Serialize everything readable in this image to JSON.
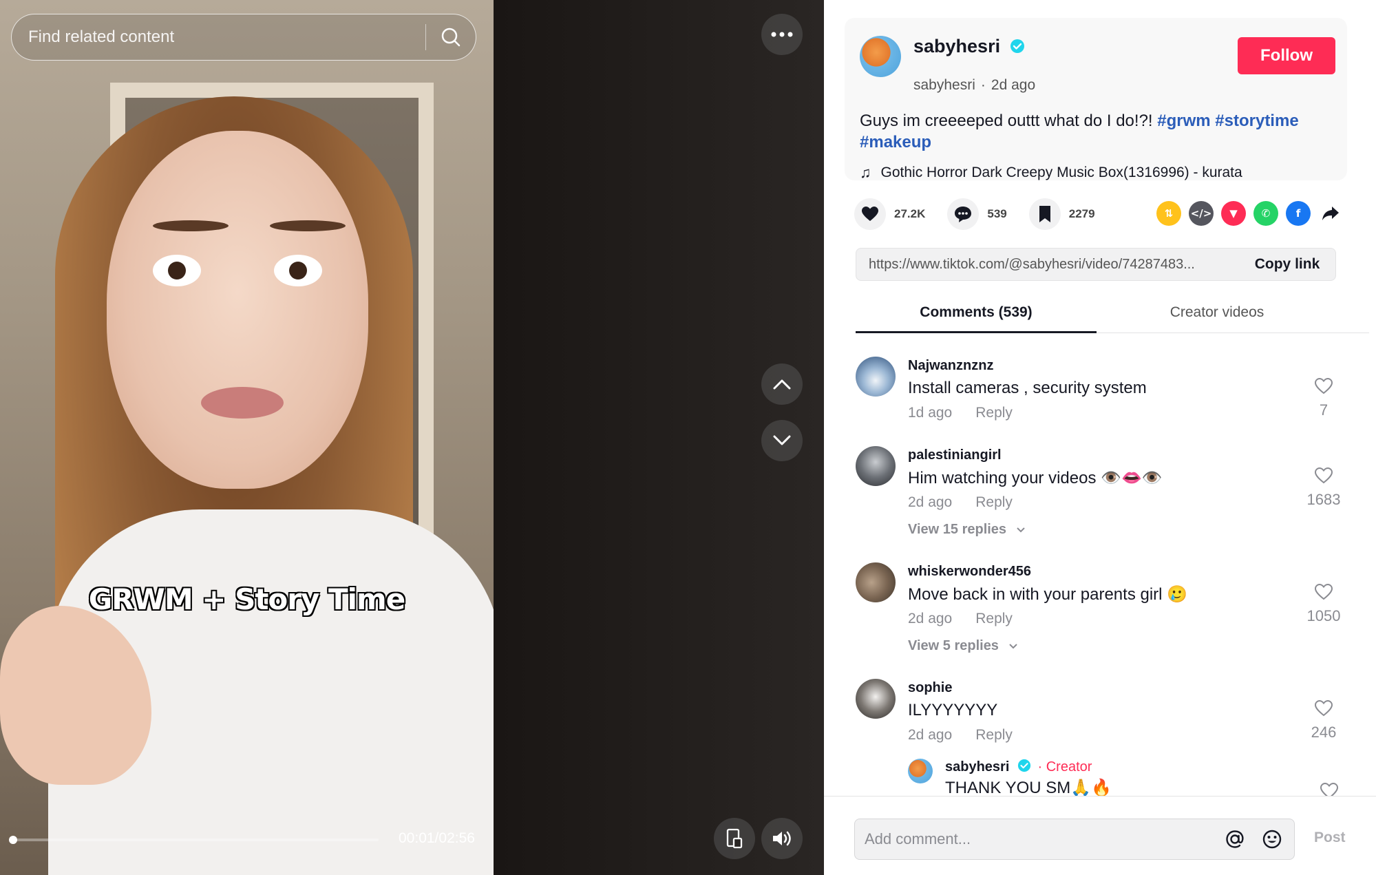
{
  "search": {
    "placeholder": "Find related content"
  },
  "video": {
    "caption": "GRWM + Story Time",
    "time": "00:01/02:56",
    "progress": 0.006
  },
  "author": {
    "display_name": "sabyhesri",
    "handle": "sabyhesri",
    "posted": "2d ago",
    "follow_label": "Follow"
  },
  "post": {
    "text": "Guys im creeeeped outtt what do I do!?! ",
    "hashtags": [
      "#grwm",
      "#storytime",
      "#makeup"
    ],
    "music": "Gothic Horror Dark Creepy Music Box(1316996) - kurata"
  },
  "stats": {
    "likes": "27.2K",
    "comments": "539",
    "saves": "2279"
  },
  "share_icons": [
    "repost-icon",
    "embed-icon",
    "send-to-friends-icon",
    "whatsapp-icon",
    "facebook-icon",
    "share-arrow-icon"
  ],
  "link": {
    "url": "https://www.tiktok.com/@sabyhesri/video/74287483...",
    "copy_label": "Copy link"
  },
  "tabs": [
    {
      "label": "Comments (539)",
      "active": true
    },
    {
      "label": "Creator videos",
      "active": false
    }
  ],
  "comments": [
    {
      "user": "Najwanznznz",
      "text": "Install cameras , security system",
      "time": "1d ago",
      "reply": "Reply",
      "likes": "7"
    },
    {
      "user": "palestiniangirl",
      "text": "Him watching your videos 👁️👄👁️",
      "time": "2d ago",
      "reply": "Reply",
      "likes": "1683",
      "view_replies": "View 15 replies"
    },
    {
      "user": "whiskerwonder456",
      "text": "Move back in with your parents girl 🥲",
      "time": "2d ago",
      "reply": "Reply",
      "likes": "1050",
      "view_replies": "View 5 replies"
    },
    {
      "user": "sophie",
      "text": "ILYYYYYYY",
      "time": "2d ago",
      "reply": "Reply",
      "likes": "246",
      "sub_reply": {
        "user": "sabyhesri",
        "badge": "· Creator",
        "text": "THANK YOU SM🙏🔥"
      }
    }
  ],
  "compose": {
    "placeholder": "Add comment...",
    "post_label": "Post"
  },
  "colors": {
    "brand": "#fe2c55",
    "hashtag": "#2b5db9",
    "verified": "#20d5ec"
  }
}
